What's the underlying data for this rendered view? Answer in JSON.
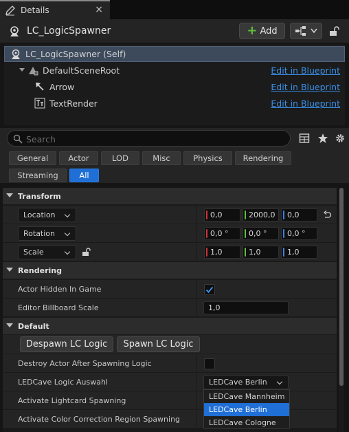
{
  "tab": {
    "title": "Details",
    "close": "×"
  },
  "header": {
    "actor_name": "LC_LogicSpawner",
    "add_label": "Add"
  },
  "tree": {
    "items": [
      {
        "label": "LC_LogicSpawner (Self)",
        "link": ""
      },
      {
        "label": "DefaultSceneRoot",
        "link": "Edit in Blueprint"
      },
      {
        "label": "Arrow",
        "link": "Edit in Blueprint"
      },
      {
        "label": "TextRender",
        "link": "Edit in Blueprint"
      }
    ]
  },
  "search": {
    "placeholder": "Search"
  },
  "filters": [
    "General",
    "Actor",
    "LOD",
    "Misc",
    "Physics",
    "Rendering",
    "Streaming",
    "All"
  ],
  "active_filter": "All",
  "transform": {
    "category": "Transform",
    "location": {
      "label": "Location",
      "x": "0,0",
      "y": "2000,0",
      "z": "0,0"
    },
    "rotation": {
      "label": "Rotation",
      "x": "0,0 °",
      "y": "0,0 °",
      "z": "0,0 °"
    },
    "scale": {
      "label": "Scale",
      "x": "1,0",
      "y": "1,0",
      "z": "1,0"
    }
  },
  "rendering": {
    "category": "Rendering",
    "hidden_label": "Actor Hidden In Game",
    "hidden_checked": true,
    "billboard_label": "Editor Billboard Scale",
    "billboard_value": "1,0"
  },
  "default": {
    "category": "Default",
    "despawn_label": "Despawn LC Logic",
    "spawn_label": "Spawn LC Logic",
    "destroy_label": "Destroy Actor After Spawning Logic",
    "destroy_checked": false,
    "logic_label": "LEDCave Logic Auswahl",
    "logic_value": "LEDCave Berlin",
    "lightcard_label": "Activate Lightcard Spawning",
    "colorcorr_label": "Activate Color Correction Region Spawning",
    "options": [
      "LEDCave Mannheim",
      "LEDCave Berlin",
      "LEDCave Cologne"
    ],
    "selected_option": "LEDCave Berlin"
  },
  "colors": {
    "accent": "#1f6fd6",
    "link": "#3a8fe8",
    "x_axis": "#d23636",
    "y_axis": "#5fbf3c",
    "z_axis": "#3a82e8"
  }
}
